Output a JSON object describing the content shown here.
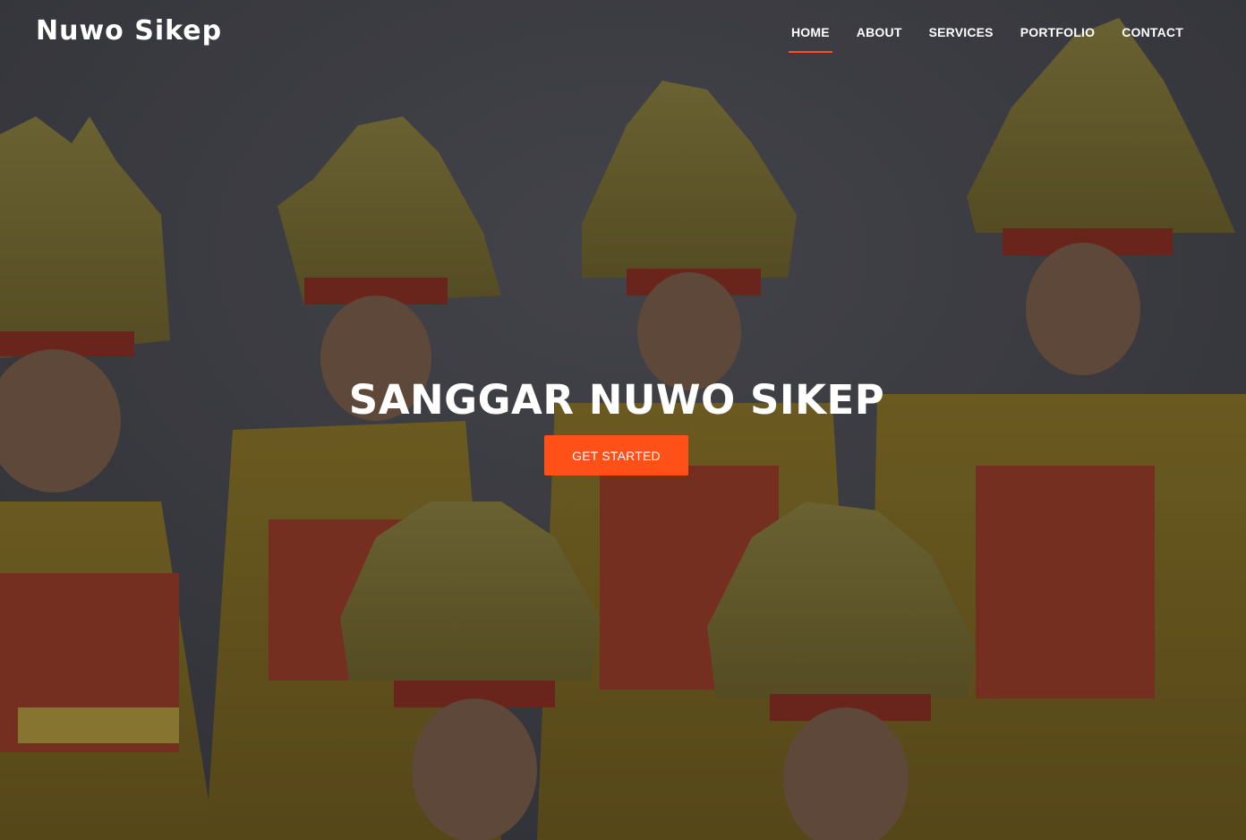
{
  "brand": {
    "name": "Nuwo Sikep"
  },
  "nav": {
    "items": [
      {
        "label": "HOME",
        "active": true
      },
      {
        "label": "ABOUT",
        "active": false
      },
      {
        "label": "SERVICES",
        "active": false
      },
      {
        "label": "PORTFOLIO",
        "active": false
      },
      {
        "label": "CONTACT",
        "active": false
      }
    ]
  },
  "hero": {
    "title": "SANGGAR NUWO SIKEP",
    "cta_label": "GET STARTED",
    "background_image": "photo of traditional dancers in gold headdresses and red-gold costumes"
  },
  "colors": {
    "accent": "#ff5117",
    "text": "#ffffff",
    "overlay": "#2f3136"
  }
}
